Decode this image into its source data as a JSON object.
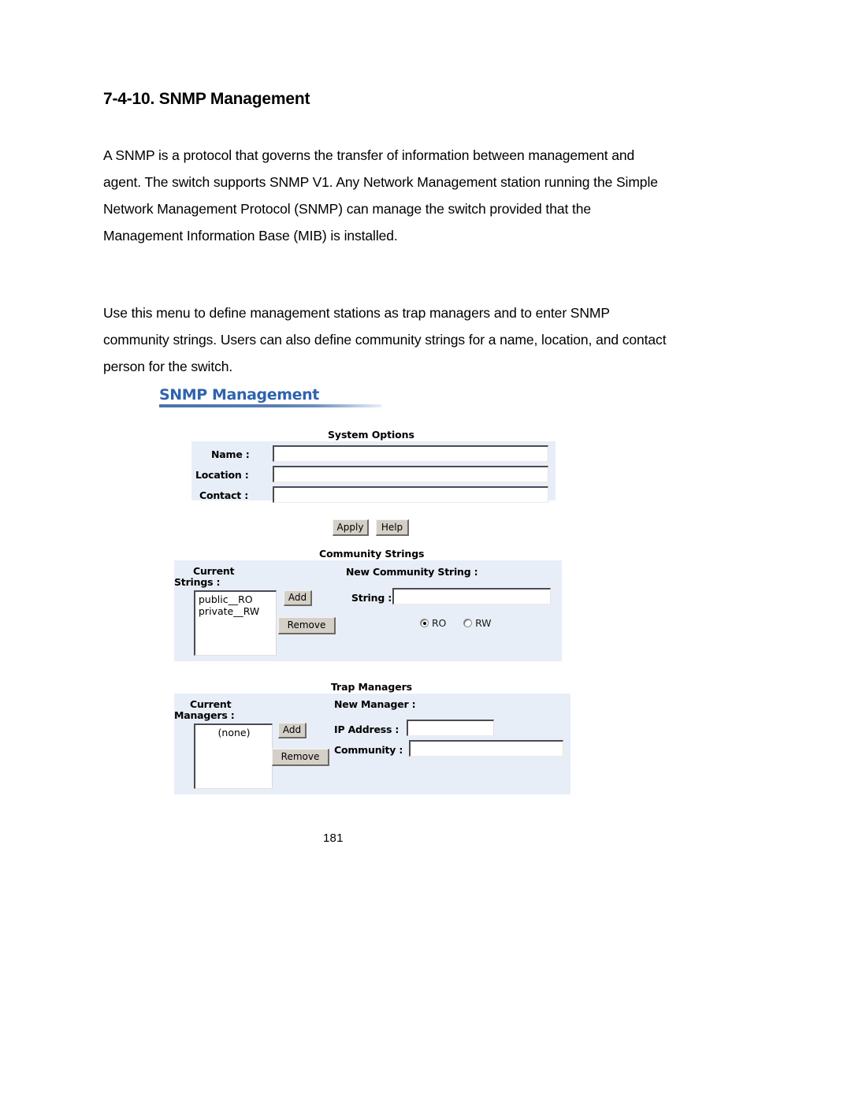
{
  "document": {
    "heading": "7-4-10. SNMP Management",
    "paragraphs": [
      "A SNMP is a protocol that governs the transfer of information between management and agent. The switch supports SNMP V1. Any Network Management station running the Simple Network Management Protocol (SNMP) can manage the switch provided that the Management Information Base (MIB) is installed.",
      "Use this menu to define management stations as trap managers and to enter SNMP community strings. Users can also define community strings for a name, location, and contact person for the switch."
    ],
    "page_number": "181"
  },
  "screenshot": {
    "title": "SNMP Management",
    "accent_color": "#2f63ad",
    "panel_color": "#e8eef7",
    "system_options": {
      "caption": "System Options",
      "fields": [
        {
          "label": "Name :",
          "value": ""
        },
        {
          "label": "Location :",
          "value": ""
        },
        {
          "label": "Contact :",
          "value": ""
        }
      ],
      "buttons": [
        {
          "label": "Apply"
        },
        {
          "label": "Help"
        }
      ]
    },
    "community_strings": {
      "caption": "Community Strings",
      "current_label_line1": "Current",
      "current_label_line2": "Strings :",
      "current_items": [
        "public__RO",
        "private__RW"
      ],
      "add_label": "Add",
      "remove_label": "Remove",
      "new_label": "New Community String :",
      "string_label": "String :",
      "string_value": "",
      "access_options": [
        {
          "label": "RO",
          "checked": true
        },
        {
          "label": "RW",
          "checked": false
        }
      ]
    },
    "trap_managers": {
      "caption": "Trap Managers",
      "current_label_line1": "Current",
      "current_label_line2": "Managers :",
      "current_items": [
        "(none)"
      ],
      "add_label": "Add",
      "remove_label": "Remove",
      "new_label": "New Manager :",
      "ip_label": "IP Address :",
      "ip_value": "",
      "community_label": "Community :",
      "community_value": ""
    }
  }
}
